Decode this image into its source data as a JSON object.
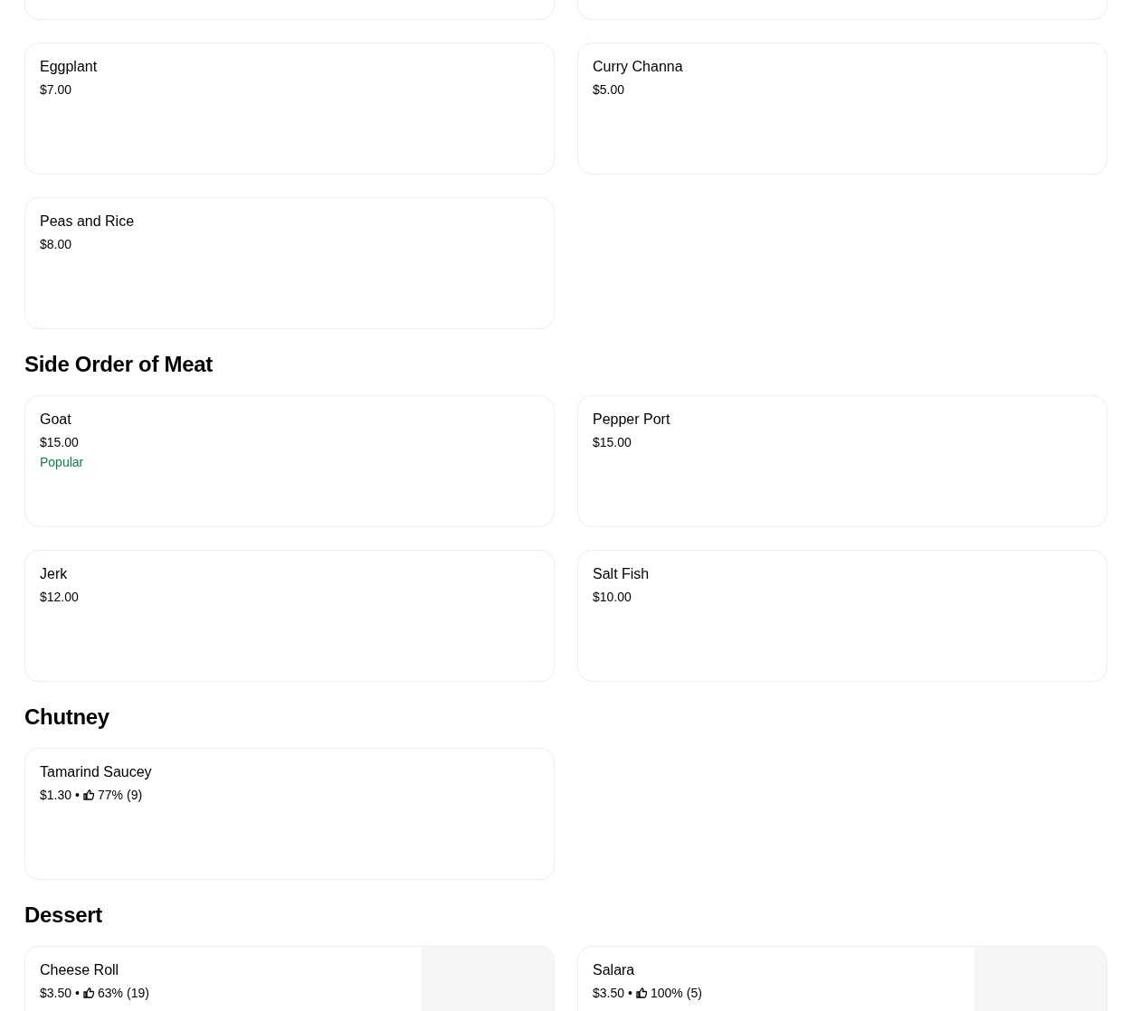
{
  "sections": [
    {
      "items": [
        {
          "kind": "cut"
        },
        {
          "kind": "cut"
        }
      ]
    },
    {
      "items": [
        {
          "kind": "item",
          "name": "Eggplant",
          "price": "$7.00"
        },
        {
          "kind": "item",
          "name": "Curry Channa",
          "price": "$5.00"
        },
        {
          "kind": "item",
          "name": "Peas and Rice",
          "price": "$8.00"
        }
      ]
    },
    {
      "title": "Side Order of Meat",
      "items": [
        {
          "kind": "item",
          "name": "Goat",
          "price": "$15.00",
          "badge": "Popular"
        },
        {
          "kind": "item",
          "name": "Pepper Port",
          "price": "$15.00"
        },
        {
          "kind": "item",
          "name": "Jerk",
          "price": "$12.00"
        },
        {
          "kind": "item",
          "name": "Salt Fish",
          "price": "$10.00"
        }
      ]
    },
    {
      "title": "Chutney",
      "items": [
        {
          "kind": "item",
          "name": "Tamarind Saucey",
          "price": "$1.30",
          "separator": "•",
          "rating": "77%",
          "count": "(9)"
        }
      ]
    },
    {
      "title": "Dessert",
      "items": [
        {
          "kind": "item",
          "name": "Cheese Roll",
          "price": "$3.50",
          "separator": "•",
          "rating": "63%",
          "count": "(19)",
          "image": true
        },
        {
          "kind": "item",
          "name": "Salara",
          "price": "$3.50",
          "separator": "•",
          "rating": "100%",
          "count": "(5)",
          "image": true
        }
      ]
    }
  ]
}
